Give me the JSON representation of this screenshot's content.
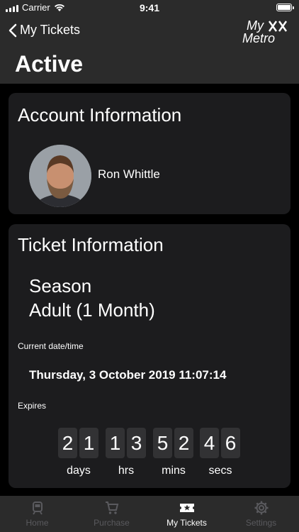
{
  "status_bar": {
    "carrier": "Carrier",
    "time": "9:41"
  },
  "nav": {
    "back_label": "My Tickets",
    "logo_line1": "My",
    "logo_line2": "Metro",
    "title": "Active"
  },
  "account": {
    "heading": "Account Information",
    "user_name": "Ron Whittle"
  },
  "ticket": {
    "heading": "Ticket Information",
    "type_line1": "Season",
    "type_line2": "Adult (1 Month)",
    "current_label": "Current date/time",
    "current_value": "Thursday, 3 October 2019 11:07:14",
    "expires_label": "Expires",
    "countdown": {
      "days": [
        "2",
        "1"
      ],
      "hrs": [
        "1",
        "3"
      ],
      "mins": [
        "5",
        "2"
      ],
      "secs": [
        "4",
        "6"
      ],
      "labels": {
        "days": "days",
        "hrs": "hrs",
        "mins": "mins",
        "secs": "secs"
      }
    }
  },
  "tabs": [
    {
      "label": "Home",
      "icon": "tram-icon",
      "active": false
    },
    {
      "label": "Purchase",
      "icon": "cart-icon",
      "active": false
    },
    {
      "label": "My Tickets",
      "icon": "ticket-icon",
      "active": true
    },
    {
      "label": "Settings",
      "icon": "gear-icon",
      "active": false
    }
  ],
  "colors": {
    "nav_bg": "#2b2b2b",
    "card_bg": "#1c1c1e",
    "digit_bg": "#323234",
    "tab_inactive": "#5a5a5e"
  }
}
